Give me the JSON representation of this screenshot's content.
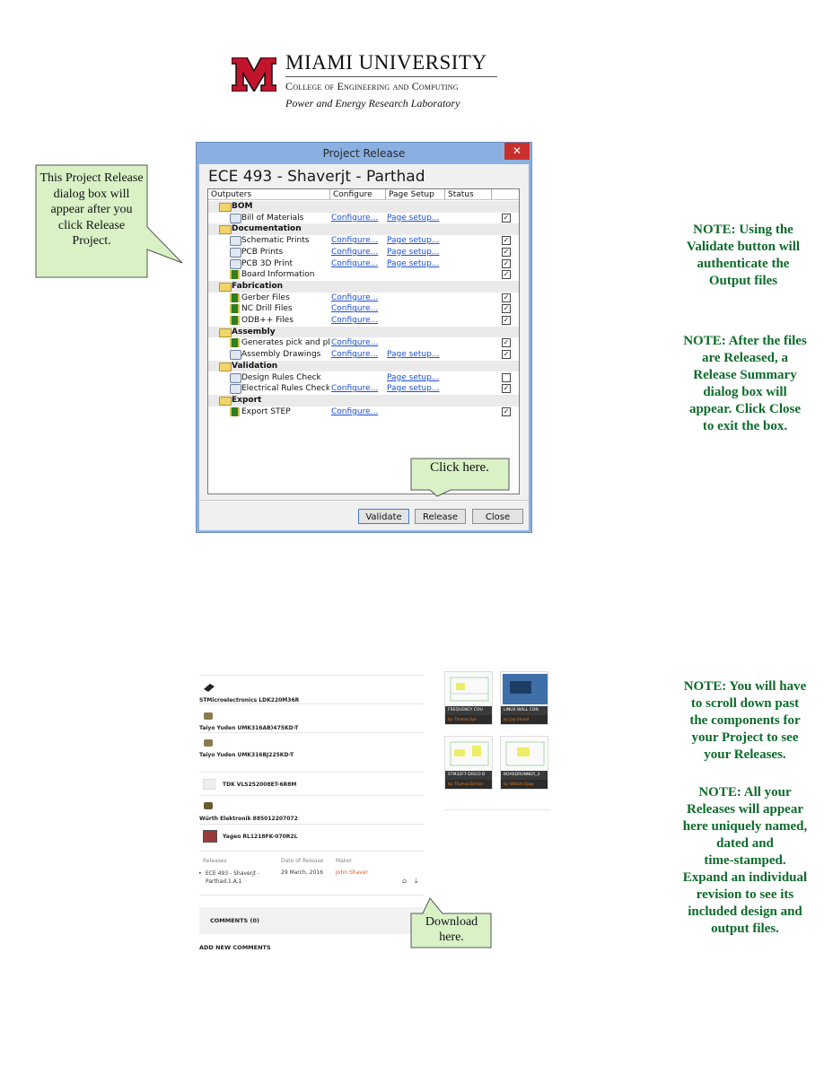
{
  "header": {
    "university": "MIAMI UNIVERSITY",
    "college": "College of Engineering and Computing",
    "lab": "Power and Energy Research Laboratory"
  },
  "callouts": {
    "dialog_info": [
      "This Project Release",
      "dialog box will",
      "appear after you",
      "click Release",
      "Project."
    ],
    "click_here": "Click here.",
    "download": [
      "Download",
      "here."
    ]
  },
  "notes": {
    "validate": [
      "NOTE: Using the",
      "Validate button will",
      "authenticate the",
      "Output files"
    ],
    "released": [
      "NOTE: After the files",
      "are Released, a",
      "Release Summary",
      "dialog box will",
      "appear. Click Close",
      "to exit the box."
    ],
    "scroll": [
      "NOTE: You will have",
      "to scroll down past",
      "the components for",
      "your Project to see",
      "your Releases."
    ],
    "named": [
      "NOTE: All your",
      "Releases will appear",
      "here uniquely named,",
      "dated and",
      "time-stamped.",
      "Expand an individual",
      "revision to see its",
      "included design and",
      "output files."
    ]
  },
  "dialog": {
    "title": "Project Release",
    "close_glyph": "✕",
    "project_name": "ECE 493 - Shaverjt - Parthad",
    "columns": [
      "Outputers",
      "Configure",
      "Page Setup",
      "Status"
    ],
    "rows": [
      {
        "type": "group",
        "label": "BOM"
      },
      {
        "type": "item",
        "icon": "printer-icon",
        "label": "Bill of Materials",
        "configure": "Configure...",
        "page_setup": "Page setup...",
        "checked": true
      },
      {
        "type": "group",
        "label": "Documentation"
      },
      {
        "type": "item",
        "icon": "printer-icon",
        "label": "Schematic Prints",
        "configure": "Configure...",
        "page_setup": "Page setup...",
        "checked": true
      },
      {
        "type": "item",
        "icon": "printer-icon",
        "label": "PCB Prints",
        "configure": "Configure...",
        "page_setup": "Page setup...",
        "checked": true
      },
      {
        "type": "item",
        "icon": "printer-icon",
        "label": "PCB 3D Print",
        "configure": "Configure...",
        "page_setup": "Page setup...",
        "checked": true
      },
      {
        "type": "item",
        "icon": "chip-icon",
        "label": "Board Information",
        "configure": "",
        "page_setup": "",
        "checked": true
      },
      {
        "type": "group",
        "label": "Fabrication"
      },
      {
        "type": "item",
        "icon": "chip-icon",
        "label": "Gerber Files",
        "configure": "Configure...",
        "page_setup": "",
        "checked": true
      },
      {
        "type": "item",
        "icon": "chip-icon",
        "label": "NC Drill Files",
        "configure": "Configure...",
        "page_setup": "",
        "checked": true
      },
      {
        "type": "item",
        "icon": "chip-icon",
        "label": "ODB++ Files",
        "configure": "Configure...",
        "page_setup": "",
        "checked": true
      },
      {
        "type": "group",
        "label": "Assembly"
      },
      {
        "type": "item",
        "icon": "chip-icon",
        "label": "Generates pick and plac",
        "configure": "Configure...",
        "page_setup": "",
        "checked": true
      },
      {
        "type": "item",
        "icon": "printer-icon",
        "label": "Assembly Drawings",
        "configure": "Configure...",
        "page_setup": "Page setup...",
        "checked": true
      },
      {
        "type": "group",
        "label": "Validation"
      },
      {
        "type": "item",
        "icon": "printer-icon",
        "label": "Design Rules Check",
        "configure": "",
        "page_setup": "Page setup...",
        "checked": false
      },
      {
        "type": "item",
        "icon": "printer-icon",
        "label": "Electrical Rules Check",
        "configure": "Configure...",
        "page_setup": "Page setup...",
        "checked": true
      },
      {
        "type": "group",
        "label": "Export"
      },
      {
        "type": "item",
        "icon": "chip-icon",
        "label": "Export STEP",
        "configure": "Configure...",
        "page_setup": "",
        "checked": true
      }
    ],
    "buttons": {
      "validate": "Validate",
      "release": "Release",
      "close": "Close"
    }
  },
  "web": {
    "components": [
      {
        "name": "STMicroelectronics LDK220M36R",
        "icon": "ic-package-icon"
      },
      {
        "name": "Taiyo Yuden UMK316AB)475KD-T",
        "icon": "capacitor-icon"
      },
      {
        "name": "Taiyo Yuden UMK316BJ225KD-T",
        "icon": "capacitor-icon"
      },
      {
        "name": "TDK VLS252008ET-6R8M",
        "icon": "inductor-icon"
      },
      {
        "name": "Würth Elektronik 885012207072",
        "icon": "capacitor-icon"
      },
      {
        "name": "Yageo RL1218FK-070R2L",
        "icon": "resistor-icon"
      }
    ],
    "releases_headers": [
      "Releases",
      "Date of Release",
      "Maker"
    ],
    "release": {
      "name": "ECE 493 - Shaverjt - Parthad.1.A.1",
      "date": "29 March, 2016",
      "maker": "John Shaver"
    },
    "comments_label": "COMMENTS (0)",
    "add_comments_label": "ADD NEW COMMENTS",
    "thumbnails": [
      {
        "title": "FREQUENCY COU",
        "by": "by: Thomas Eye"
      },
      {
        "title": "LINUX WALL CON",
        "by": "by: Jay Gerard"
      },
      {
        "title": "STM32F7-DISCO B",
        "by": "by: Thomas Eichner"
      },
      {
        "title": "BOARDRUNNER_3",
        "by": "by: William Quay"
      }
    ]
  }
}
